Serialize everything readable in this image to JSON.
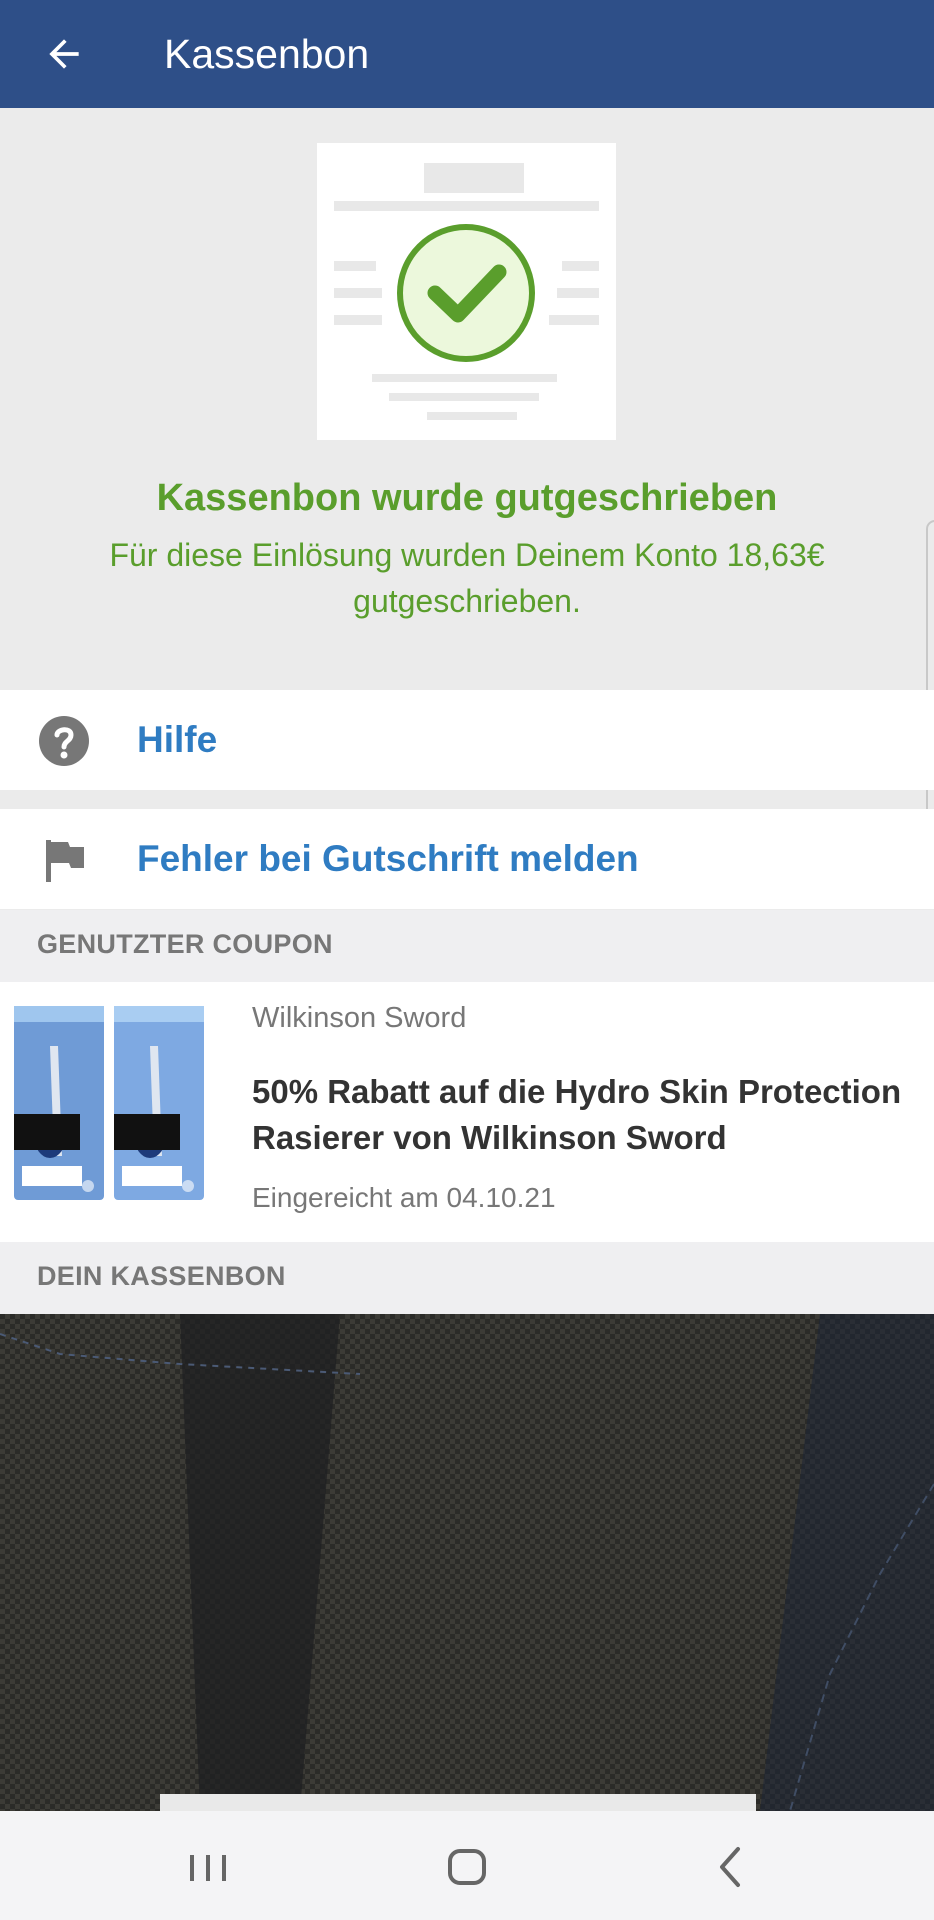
{
  "appbar": {
    "title": "Kassenbon"
  },
  "status": {
    "title": "Kassenbon wurde gutgeschrieben",
    "message": "Für diese Einlösung wurden Deinem Konto 18,63€ gutgeschrieben.",
    "color": "#5a9e2c"
  },
  "actions": {
    "help_label": "Hilfe",
    "report_label": "Fehler bei Gutschrift melden"
  },
  "sections": {
    "used_coupon": "GENUTZTER COUPON",
    "your_receipt": "DEIN KASSENBON"
  },
  "coupon": {
    "brand": "Wilkinson Sword",
    "title": "50% Rabatt auf die Hydro Skin Protection Rasierer von Wilkinson Sword",
    "submitted": "Eingereicht am 04.10.21"
  },
  "colors": {
    "appbar": "#2e4f88",
    "link": "#2f7cc2",
    "success": "#5a9e2c"
  },
  "icons": [
    "back-arrow-icon",
    "receipt-check-illustration",
    "help-icon",
    "flag-icon",
    "recents-icon",
    "home-icon",
    "nav-back-icon"
  ]
}
